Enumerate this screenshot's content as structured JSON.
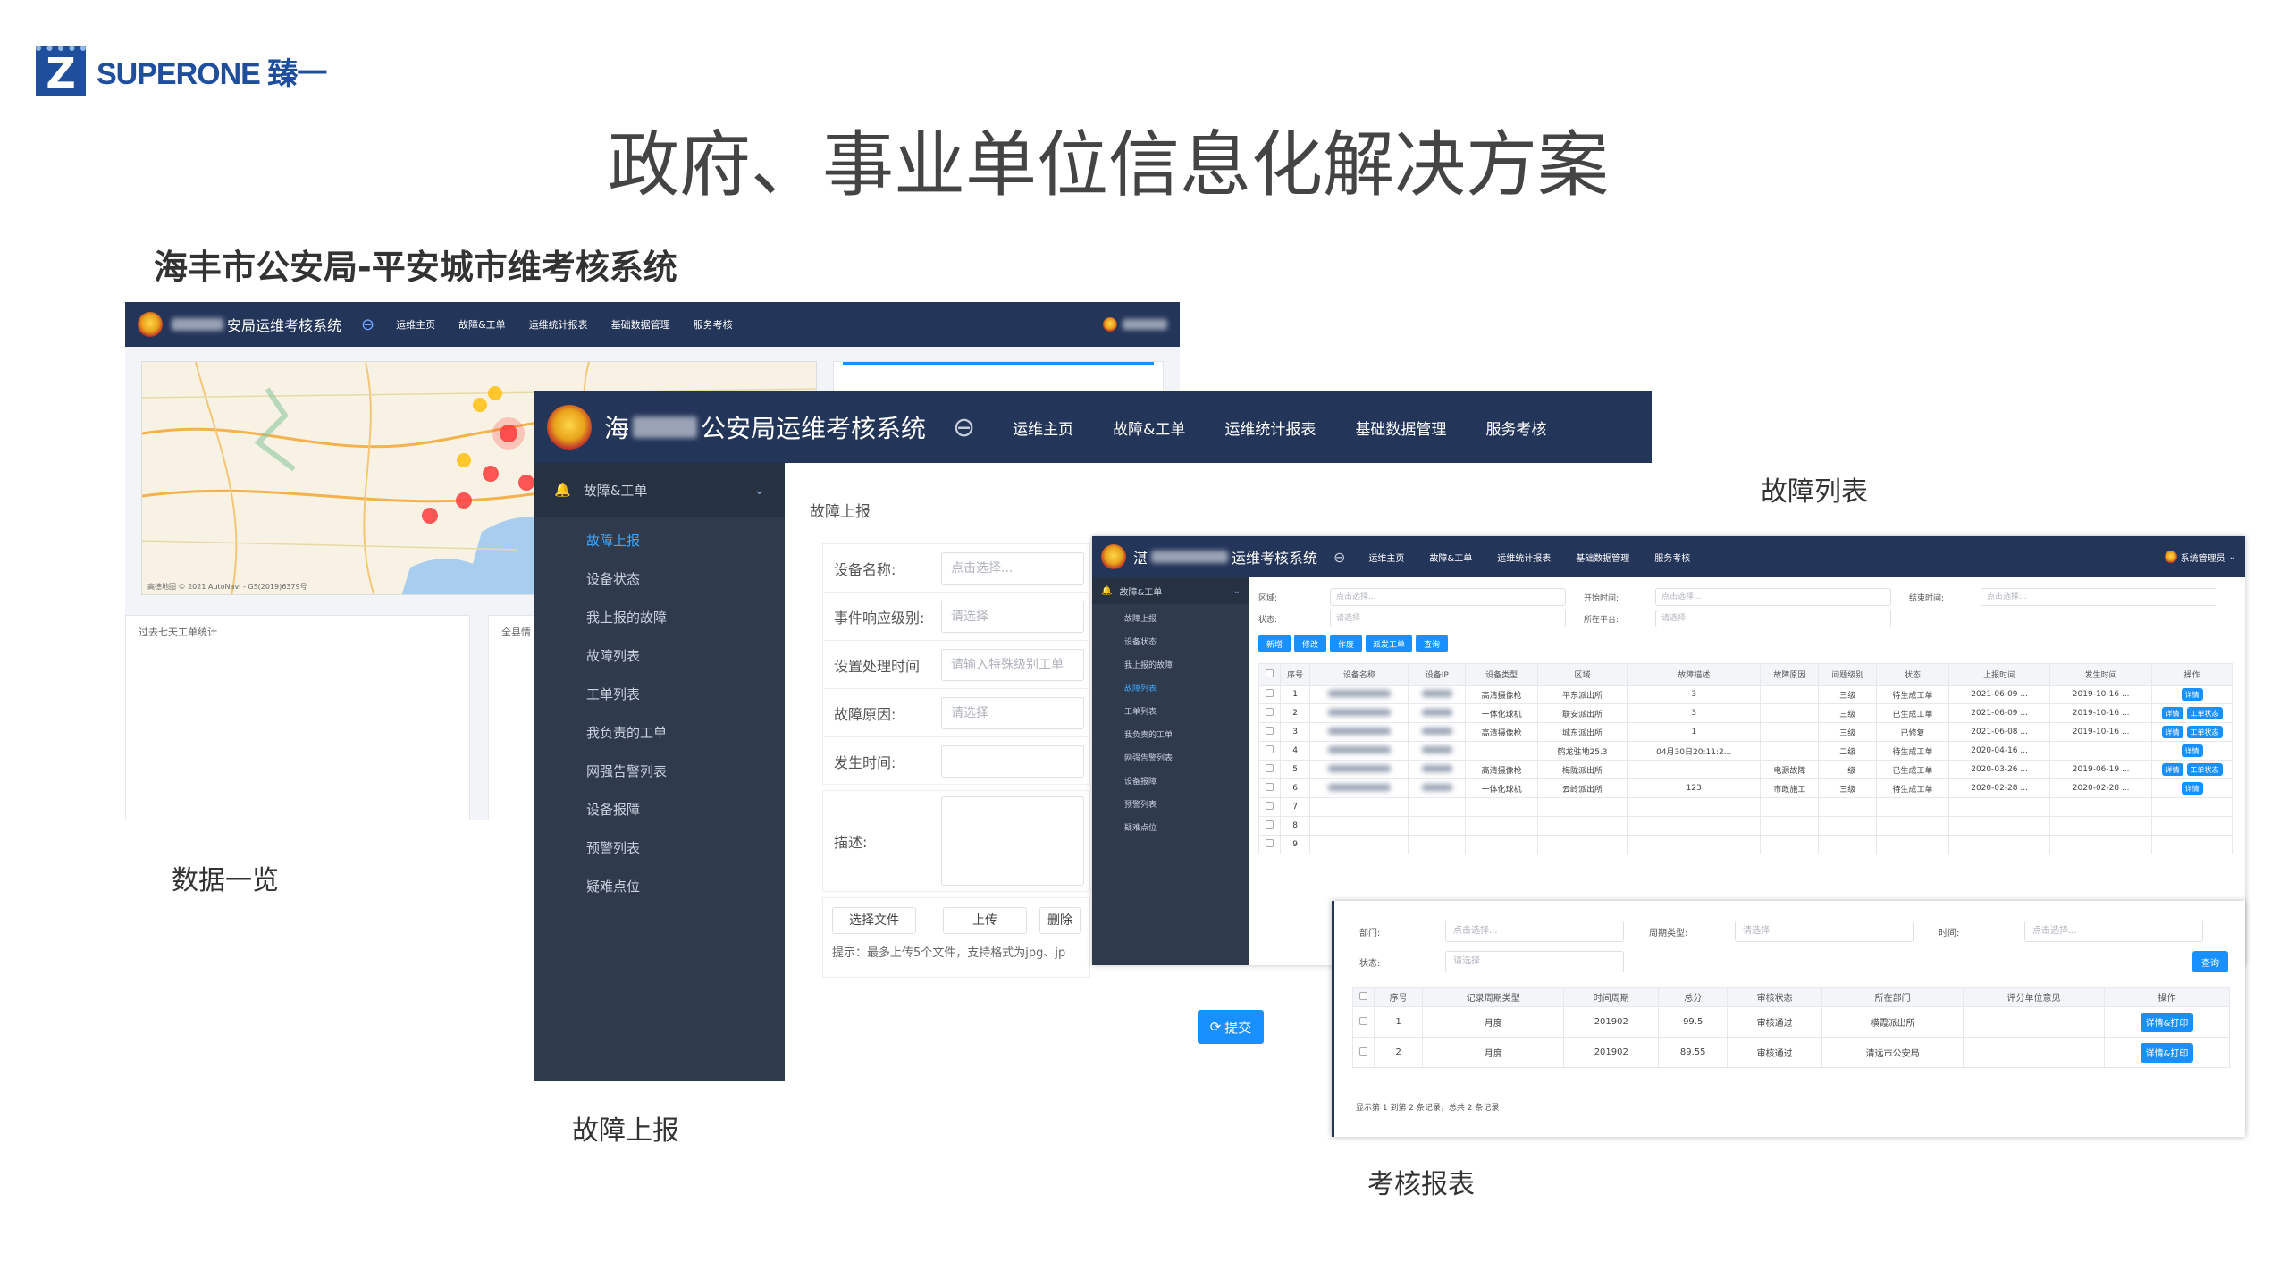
{
  "brand": {
    "logo_letter": "Z",
    "name": "SUPERONE 臻一"
  },
  "slide": {
    "title": "政府、事业单位信息化解决方案",
    "subtitle": "海丰市公安局-平安城市维考核系统"
  },
  "captions": {
    "overview": "数据一览",
    "fault_report": "故障上报",
    "fault_list": "故障列表",
    "assessment": "考核报表"
  },
  "colors": {
    "navbar": "#24355a",
    "sidebar": "#2f3a4c",
    "accent": "#1890ff"
  },
  "s1": {
    "title_suffix": "安局运维考核系统",
    "nav": [
      "运维主页",
      "故障&工单",
      "运维统计报表",
      "基础数据管理",
      "服务考核"
    ],
    "map_credit": "高德地图 © 2021 AutoNavi - GS(2019)6379号",
    "panel1_title": "过去七天工单统计",
    "panel2_title": "全县情"
  },
  "s2": {
    "title_main": "公安局运维考核系统",
    "title_prefix": "海",
    "nav": [
      "运维主页",
      "故障&工单",
      "运维统计报表",
      "基础数据管理",
      "服务考核"
    ],
    "menu_header": "故障&工单",
    "menu": [
      "故障上报",
      "设备状态",
      "我上报的故障",
      "故障列表",
      "工单列表",
      "我负责的工单",
      "网强告警列表",
      "设备报障",
      "预警列表",
      "疑难点位"
    ],
    "page_title": "故障上报",
    "fields": [
      {
        "label": "设备名称:",
        "placeholder": "点击选择..."
      },
      {
        "label": "事件响应级别:",
        "placeholder": "请选择"
      },
      {
        "label": "设置处理时间",
        "placeholder": "请输入特殊级别工单"
      },
      {
        "label": "故障原因:",
        "placeholder": "请选择"
      },
      {
        "label": "发生时间:",
        "placeholder": ""
      }
    ],
    "desc_label": "描述:",
    "choose_file": "选择文件",
    "upload": "上传",
    "delete": "删除",
    "hint": "提示：最多上传5个文件，支持格式为jpg、jp",
    "submit": "提交"
  },
  "s3": {
    "title_prefix": "湛",
    "title_main": "运维考核系统",
    "nav": [
      "运维主页",
      "故障&工单",
      "运维统计报表",
      "基础数据管理",
      "服务考核"
    ],
    "user": "系统管理员",
    "menu_header": "故障&工单",
    "menu": [
      "故障上报",
      "设备状态",
      "我上报的故障",
      "故障列表",
      "工单列表",
      "我负责的工单",
      "网强告警列表",
      "设备报障",
      "预警列表",
      "疑难点位"
    ],
    "filters": [
      {
        "label": "区域:",
        "placeholder": "点击选择..."
      },
      {
        "label": "开始时间:",
        "placeholder": "点击选择..."
      },
      {
        "label": "结束时间:",
        "placeholder": "点击选择..."
      },
      {
        "label": "状态:",
        "placeholder": "请选择"
      },
      {
        "label": "所在平台:",
        "placeholder": "请选择"
      }
    ],
    "buttons": [
      "新增",
      "修改",
      "作废",
      "派发工单",
      "查询"
    ],
    "columns": [
      "序号",
      "设备名称",
      "设备IP",
      "设备类型",
      "区域",
      "故障描述",
      "故障原因",
      "问题级别",
      "状态",
      "上报时间",
      "发生时间",
      "操作"
    ],
    "rows": [
      {
        "no": "1",
        "type": "高清摄像枪",
        "area": "平东派出所",
        "desc": "3",
        "reason": "",
        "level": "三级",
        "status": "待生成工单",
        "report": "2021-06-09 ...",
        "occur": "2019-10-16 ...",
        "ops": [
          "详情"
        ]
      },
      {
        "no": "2",
        "type": "一体化球机",
        "area": "联安派出所",
        "desc": "3",
        "reason": "",
        "level": "三级",
        "status": "已生成工单",
        "report": "2021-06-09 ...",
        "occur": "2019-10-16 ...",
        "ops": [
          "详情",
          "工单状态"
        ]
      },
      {
        "no": "3",
        "type": "高清摄像枪",
        "area": "城东派出所",
        "desc": "1",
        "reason": "",
        "level": "三级",
        "status": "已修复",
        "report": "2021-06-08 ...",
        "occur": "2019-10-16 ...",
        "ops": [
          "详情",
          "工单状态"
        ]
      },
      {
        "no": "4",
        "type": "",
        "area": "鹤龙驻地25.3",
        "desc": "04月30日20:11:2...",
        "reason": "",
        "level": "二级",
        "status": "待生成工单",
        "report": "2020-04-16 ...",
        "occur": "",
        "ops": [
          "详情"
        ]
      },
      {
        "no": "5",
        "type": "高清摄像枪",
        "area": "梅陇派出所",
        "desc": "",
        "reason": "电源故障",
        "level": "一级",
        "status": "已生成工单",
        "report": "2020-03-26 ...",
        "occur": "2019-06-19 ...",
        "ops": [
          "详情",
          "工单状态"
        ]
      },
      {
        "no": "6",
        "type": "一体化球机",
        "area": "云岭派出所",
        "desc": "123",
        "reason": "市政施工",
        "level": "三级",
        "status": "待生成工单",
        "report": "2020-02-28 ...",
        "occur": "2020-02-28 ...",
        "ops": [
          "详情"
        ]
      },
      {
        "no": "7"
      },
      {
        "no": "8"
      },
      {
        "no": "9"
      }
    ]
  },
  "s4": {
    "filters": [
      {
        "label": "部门:",
        "placeholder": "点击选择..."
      },
      {
        "label": "周期类型:",
        "placeholder": "请选择"
      },
      {
        "label": "时间:",
        "placeholder": "点击选择..."
      },
      {
        "label": "状态:",
        "placeholder": "请选择"
      }
    ],
    "query": "查询",
    "columns": [
      "序号",
      "记录周期类型",
      "时间周期",
      "总分",
      "审核状态",
      "所在部门",
      "评分单位意见",
      "操作"
    ],
    "rows": [
      {
        "no": "1",
        "cycle": "月度",
        "period": "201902",
        "score": "99.5",
        "audit": "审核通过",
        "dept": "横霞派出所",
        "opinion": "",
        "op": "详情&打印"
      },
      {
        "no": "2",
        "cycle": "月度",
        "period": "201902",
        "score": "89.55",
        "audit": "审核通过",
        "dept": "清远市公安局",
        "opinion": "",
        "op": "详情&打印"
      }
    ],
    "footer": "显示第 1 到第 2 条记录，总共 2 条记录"
  }
}
